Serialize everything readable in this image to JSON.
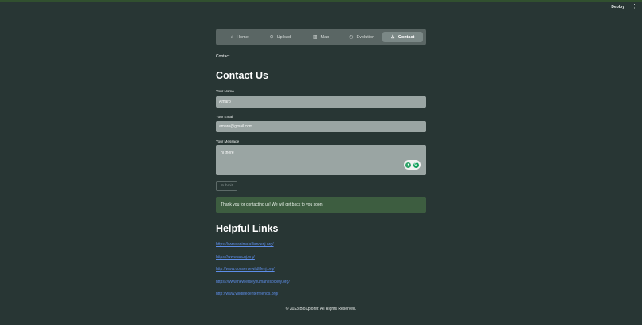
{
  "topbar": {
    "deploy_label": "Deploy",
    "menu_icon": "kebab-menu-icon"
  },
  "nav": {
    "items": [
      {
        "label": "Home",
        "icon": "home-icon",
        "active": false
      },
      {
        "label": "Upload",
        "icon": "upload-icon",
        "active": false
      },
      {
        "label": "Map",
        "icon": "map-icon",
        "active": false
      },
      {
        "label": "Evolution",
        "icon": "clock-icon",
        "active": false
      },
      {
        "label": "Contact",
        "icon": "person-icon",
        "active": true
      }
    ]
  },
  "breadcrumb": "Contact",
  "form": {
    "title": "Contact Us",
    "name_label": "Your Name",
    "name_value": "Amaro",
    "email_label": "Your Email",
    "email_value": "amaro@gmail.com",
    "message_label": "Your Message",
    "message_value": "hi there",
    "submit_label": "Submit",
    "success_message": "Thank you for contacting us! We will get back to you soon."
  },
  "links": {
    "title": "Helpful Links",
    "items": [
      "https://www.animalalliancenj.org/",
      "https://www.aacnj.org/",
      "http://www.conservewildlifenj.org/",
      "https://www.newjerseyhumanesociety.org/",
      "http://www.wildlifecenterfriends.org/"
    ]
  },
  "footer": "© 2023 BioXplorer. All Rights Reserved.",
  "colors": {
    "background": "#283634",
    "nav_bg": "#5a6664",
    "input_bg": "#9aa5a3",
    "success_bg": "#3d5d40",
    "link": "#5d8de8"
  }
}
